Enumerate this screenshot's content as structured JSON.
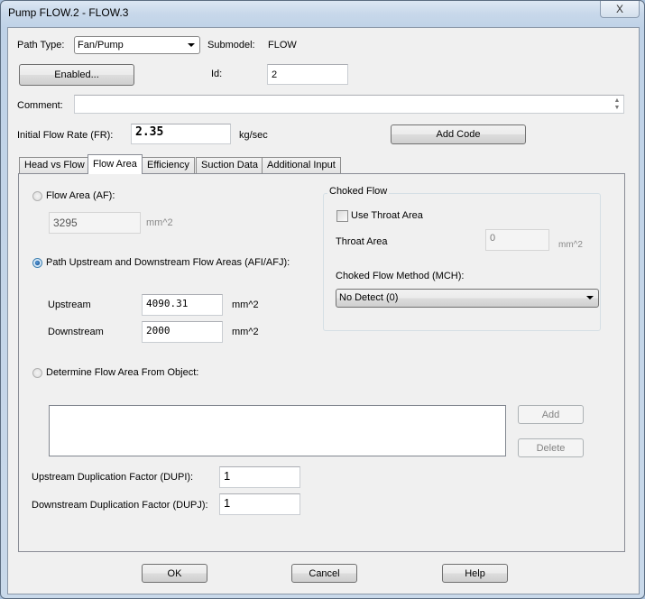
{
  "window": {
    "title": "Pump FLOW.2 - FLOW.3",
    "close_label": "X"
  },
  "header": {
    "path_type_label": "Path Type:",
    "path_type_value": "Fan/Pump",
    "submodel_label": "Submodel:",
    "submodel_value": "FLOW",
    "enabled_button": "Enabled...",
    "id_label": "Id:",
    "id_value": "2",
    "comment_label": "Comment:",
    "comment_value": "",
    "initial_flow_label": "Initial Flow Rate (FR):",
    "initial_flow_value": "2.35",
    "initial_flow_unit": "kg/sec",
    "add_code_button": "Add Code"
  },
  "tabs": [
    {
      "label": "Head vs Flow",
      "active": false
    },
    {
      "label": "Flow Area",
      "active": true
    },
    {
      "label": "Efficiency",
      "active": false
    },
    {
      "label": "Suction Data",
      "active": false
    },
    {
      "label": "Additional Input",
      "active": false
    }
  ],
  "flow_area_tab": {
    "option_flow_area": {
      "label": "Flow Area (AF):",
      "selected": false,
      "value": "3295",
      "unit": "mm^2"
    },
    "option_path_areas": {
      "label": "Path Upstream and Downstream Flow Areas (AFI/AFJ):",
      "selected": true,
      "upstream_label": "Upstream",
      "upstream_value": "4090.31",
      "upstream_unit": "mm^2",
      "downstream_label": "Downstream",
      "downstream_value": "2000",
      "downstream_unit": "mm^2"
    },
    "option_from_object": {
      "label": "Determine Flow Area From Object:",
      "selected": false
    },
    "object_list": [],
    "add_button": "Add",
    "delete_button": "Delete",
    "dupi_label": "Upstream Duplication Factor (DUPI):",
    "dupi_value": "1",
    "dupj_label": "Downstream Duplication Factor (DUPJ):",
    "dupj_value": "1",
    "choked_flow": {
      "title": "Choked Flow",
      "use_throat_label": "Use Throat Area",
      "use_throat_checked": false,
      "throat_area_label": "Throat Area",
      "throat_area_value": "0",
      "throat_area_unit": "mm^2",
      "method_label": "Choked Flow Method (MCH):",
      "method_value": "No Detect (0)"
    }
  },
  "footer": {
    "ok": "OK",
    "cancel": "Cancel",
    "help": "Help"
  }
}
